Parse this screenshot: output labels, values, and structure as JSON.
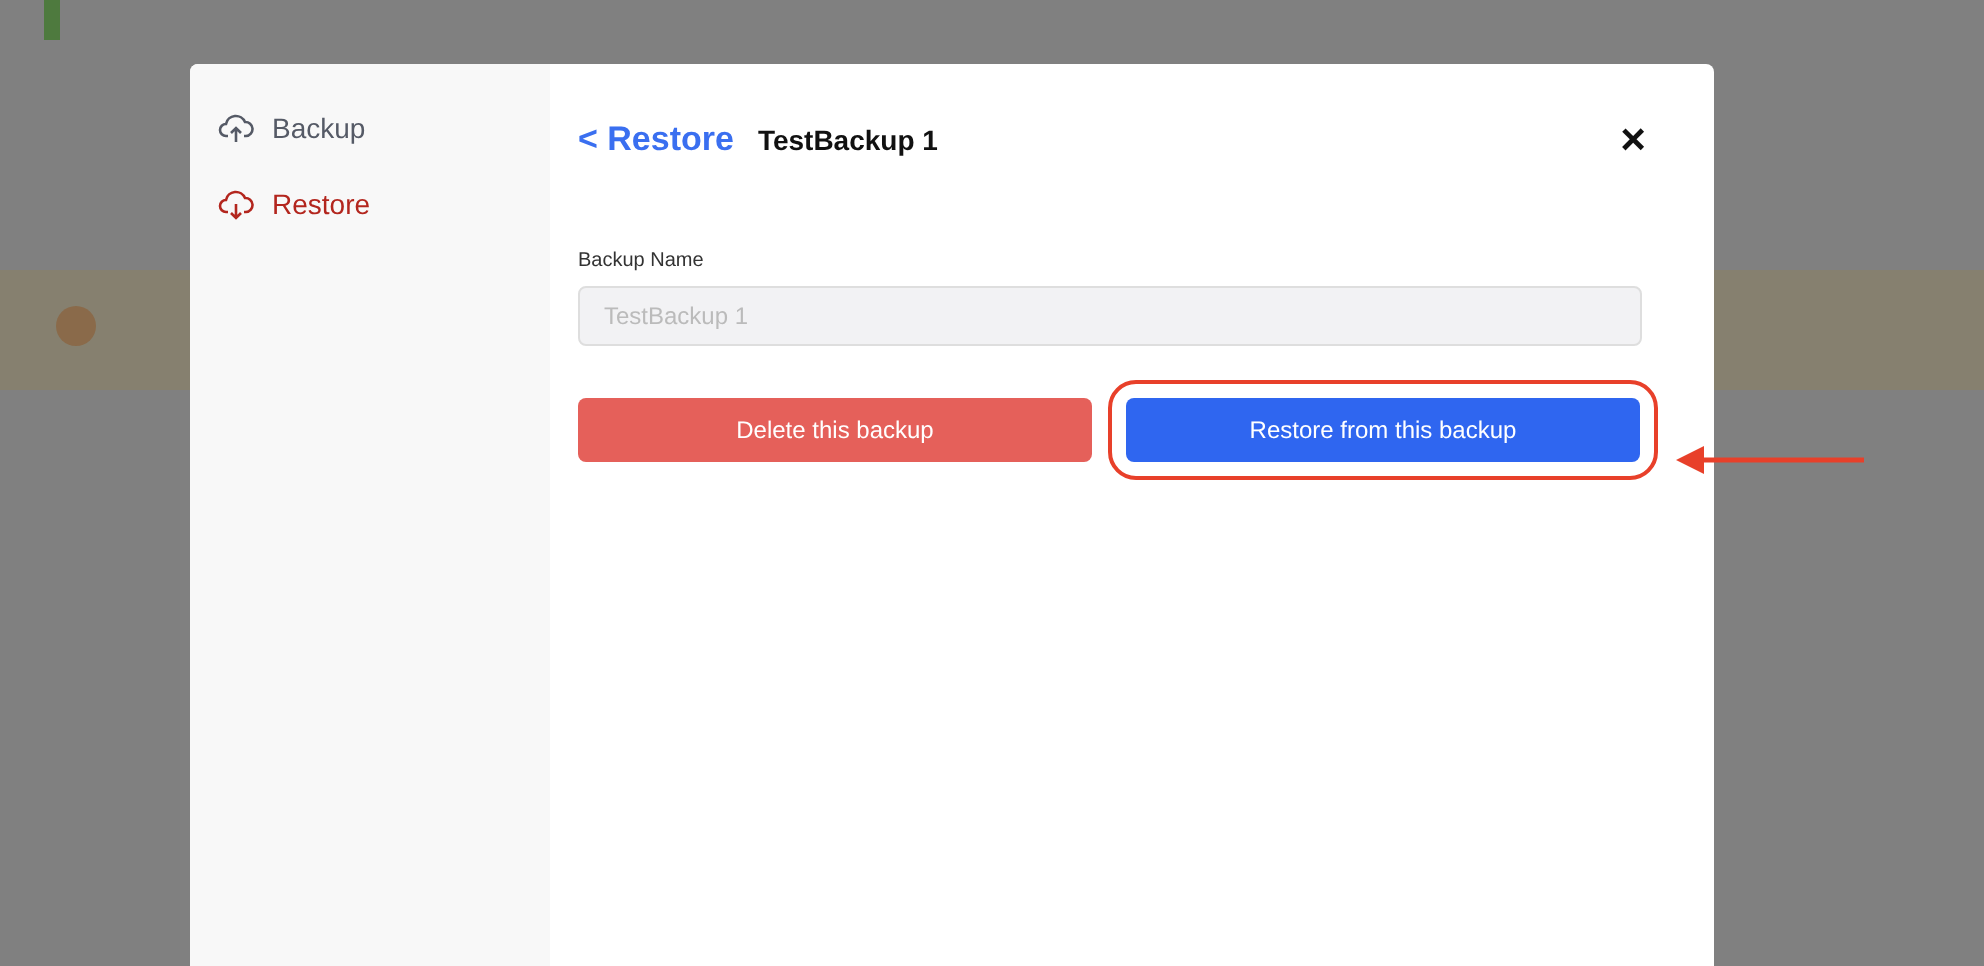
{
  "sidebar": {
    "items": [
      {
        "label": "Backup",
        "kind": "upload",
        "selected": false
      },
      {
        "label": "Restore",
        "kind": "download",
        "selected": true
      }
    ]
  },
  "header": {
    "back_link": "< Restore",
    "title": "TestBackup 1",
    "close": "×"
  },
  "field": {
    "label": "Backup Name",
    "placeholder": "TestBackup 1",
    "disabled": true
  },
  "buttons": [
    {
      "label": "Delete this backup",
      "kind": "danger",
      "highlighted": false
    },
    {
      "label": "Restore from this backup",
      "kind": "primary",
      "highlighted": true
    }
  ]
}
